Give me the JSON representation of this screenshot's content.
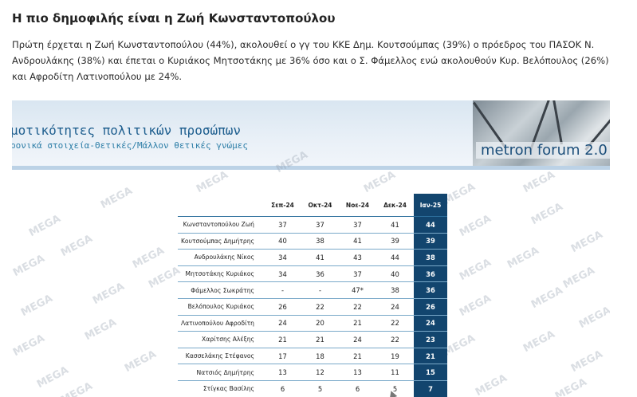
{
  "article": {
    "headline": "Η πιο δημοφιλής είναι η Ζωή Κωνσταντοπούλου",
    "lead": "Πρώτη έρχεται η Ζωή Κωνσταντοπούλου (44%), ακολουθεί ο γγ του ΚΚΕ Δημ. Κουτσούμπας (39%) ο πρόεδρος του ΠΑΣΟΚ Ν. Ανδρουλάκης (38%) και έπεται ο Κυριάκος Μητσοτάκης με 36% όσο και ο Σ. Φάμελλος ενώ ακολουθούν Κυρ. Βελόπουλος (26%) και Αφροδίτη Λατινοπούλου με 24%."
  },
  "slide": {
    "title": "μοτικότητες πολιτικών προσώπων",
    "subtitle": "ρονικά στοιχεία-Θετικές/Μάλλον θετικές γνώμες",
    "brand": "metron forum 2.0",
    "watermark": "MEGA",
    "accent": "#12456e"
  },
  "table": {
    "headers": [
      "Σεπ-24",
      "Οκτ-24",
      "Νοε-24",
      "Δεκ-24",
      "Ιαν-25"
    ],
    "rows": [
      {
        "name": "Κωνσταντοπούλου Ζωή",
        "values": [
          "37",
          "37",
          "37",
          "41",
          "44"
        ]
      },
      {
        "name": "Κουτσούμπας Δημήτρης",
        "values": [
          "40",
          "38",
          "41",
          "39",
          "39"
        ]
      },
      {
        "name": "Ανδρουλάκης Νίκος",
        "values": [
          "34",
          "41",
          "43",
          "44",
          "38"
        ]
      },
      {
        "name": "Μητσοτάκης Κυριάκος",
        "values": [
          "34",
          "36",
          "37",
          "40",
          "36"
        ]
      },
      {
        "name": "Φάμελλος Σωκράτης",
        "values": [
          "-",
          "-",
          "47*",
          "38",
          "36"
        ]
      },
      {
        "name": "Βελόπουλος Κυριάκος",
        "values": [
          "26",
          "22",
          "22",
          "24",
          "26"
        ]
      },
      {
        "name": "Λατινοπούλου Αφροδίτη",
        "values": [
          "24",
          "20",
          "21",
          "22",
          "24"
        ]
      },
      {
        "name": "Χαρίτσης Αλέξης",
        "values": [
          "21",
          "21",
          "24",
          "22",
          "23"
        ]
      },
      {
        "name": "Κασσελάκης Στέφανος",
        "values": [
          "17",
          "18",
          "21",
          "19",
          "21"
        ]
      },
      {
        "name": "Νατσιός Δημήτρης",
        "values": [
          "13",
          "12",
          "13",
          "11",
          "15"
        ]
      },
      {
        "name": "Στίγκας Βασίλης",
        "values": [
          "6",
          "5",
          "6",
          "5",
          "7"
        ]
      }
    ]
  }
}
